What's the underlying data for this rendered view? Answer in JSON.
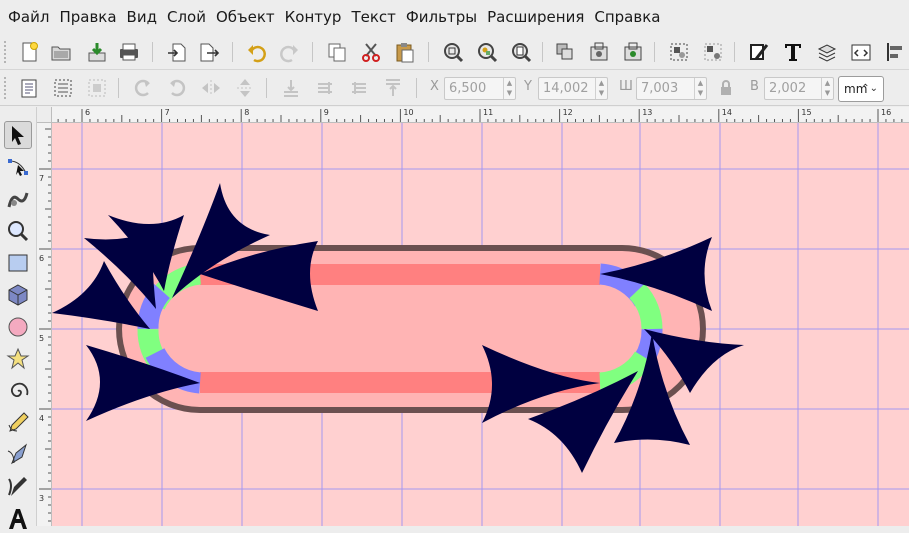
{
  "menu": {
    "file": "Файл",
    "edit": "Правка",
    "view": "Вид",
    "layer": "Слой",
    "object": "Объект",
    "path": "Контур",
    "text": "Текст",
    "filters": "Фильтры",
    "extensions": "Расширения",
    "help": "Справка"
  },
  "controls": {
    "x_label": "X",
    "x_value": "6,500",
    "y_label": "Y",
    "y_value": "14,002",
    "w_label": "Ш",
    "w_value": "7,003",
    "h_label": "В",
    "h_value": "2,002",
    "unit": "mm",
    "lock_icon": "lock-icon"
  },
  "ruler": {
    "h_labels": [
      "6",
      "7",
      "8",
      "9",
      "10",
      "11",
      "12",
      "13",
      "14",
      "15",
      "16"
    ],
    "v_labels": [
      "7",
      "6",
      "5",
      "4",
      "3"
    ]
  },
  "colors": {
    "canvas_bg": "#ffd0d0",
    "outline": "#6b5050",
    "fill": "#ffb4b4",
    "straight_segment": "#ff8080",
    "arc_blue": "#8080ff",
    "arc_green": "#80ff80",
    "arrow": "#000040",
    "guide": "#8080ff"
  }
}
